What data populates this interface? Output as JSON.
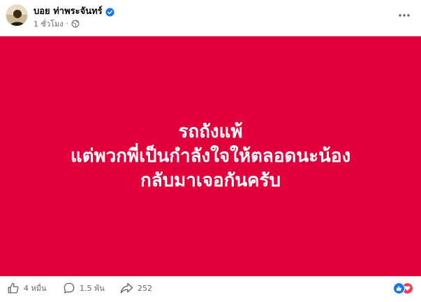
{
  "post": {
    "author": "บอย ท่าพระจันทร์",
    "timestamp": "1 ชั่วโมง",
    "separator": "·",
    "audience_icon": "globe-icon",
    "verified_icon": "verified-badge-icon",
    "more_icon": "more-options-icon"
  },
  "image": {
    "background_color": "#e1003a",
    "text_color": "#ffffff",
    "lines": [
      "รถถังแพ้",
      "แต่พวกพี่เป็นกำลังใจให้ตลอดนะน้อง",
      "กลับมาเจอกันครับ"
    ]
  },
  "actions": {
    "like_count": "4 หมื่น",
    "comment_count": "1.5 พัน",
    "share_count": "252",
    "reactions": [
      "like",
      "love"
    ]
  }
}
